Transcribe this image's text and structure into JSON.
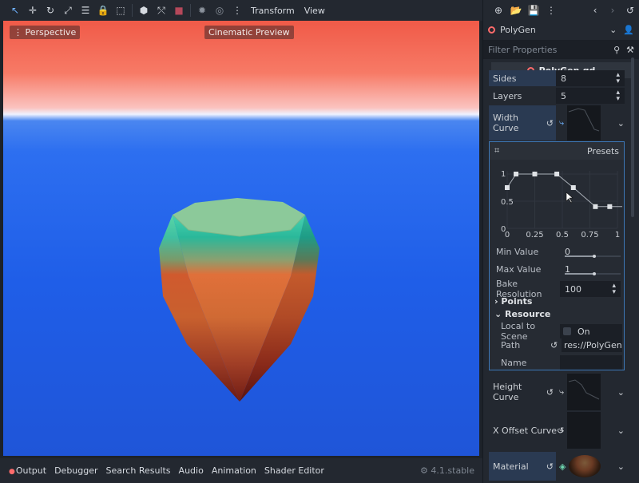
{
  "toolbar": {
    "icons": [
      "select-arrow-icon",
      "move-icon",
      "rotate-icon",
      "scale-icon",
      "list-select-icon",
      "lock-icon",
      "group-icon",
      "ruler-icon",
      "snap-icon",
      "camera-icon",
      "sun-icon",
      "environment-icon",
      "more-icon"
    ],
    "transform_label": "Transform",
    "view_label": "View"
  },
  "viewport": {
    "perspective_label": "Perspective",
    "cinematic_label": "Cinematic Preview"
  },
  "bottom": {
    "tabs": [
      "Output",
      "Debugger",
      "Search Results",
      "Audio",
      "Animation",
      "Shader Editor"
    ],
    "version": "4.1.stable"
  },
  "inspector": {
    "node_name": "PolyGen",
    "filter_placeholder": "Filter Properties",
    "script_name": "PolyGen.gd",
    "sides_label": "Sides",
    "sides_value": "8",
    "layers_label": "Layers",
    "layers_value": "5",
    "width_curve_label": "Width Curve",
    "presets_label": "Presets",
    "curve_ticks_y": [
      "1",
      "0.5",
      "0"
    ],
    "curve_ticks_x": [
      "0",
      "0.25",
      "0.5",
      "0.75",
      "1"
    ],
    "curve_points": [
      [
        0,
        0.75
      ],
      [
        0.08,
        1.0
      ],
      [
        0.25,
        1.0
      ],
      [
        0.45,
        1.0
      ],
      [
        0.6,
        0.75
      ],
      [
        0.8,
        0.4
      ],
      [
        0.93,
        0.4
      ]
    ],
    "min_value_label": "Min Value",
    "min_value": "0",
    "max_value_label": "Max Value",
    "max_value": "1",
    "bake_label": "Bake Resolution",
    "bake_value": "100",
    "points_label": "Points",
    "resource_label": "Resource",
    "local_scene_label": "Local to Scene",
    "local_scene_value": "On",
    "path_label": "Path",
    "path_value": "res://PolyGen.t",
    "name_label": "Name",
    "height_curve_label": "Height Curve",
    "x_offset_label": "X Offset Curve",
    "material_label": "Material"
  },
  "colors": {
    "accent": "#3d78b8",
    "node_ring": "#ff6b6b",
    "script_ring": "#ff6b6b"
  }
}
